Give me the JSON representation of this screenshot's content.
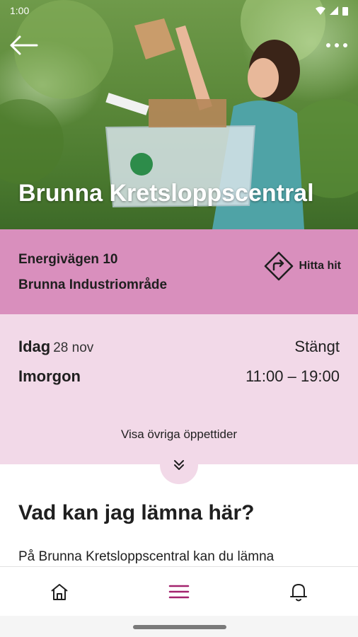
{
  "status_bar": {
    "time": "1:00"
  },
  "hero": {
    "title": "Brunna Kretsloppscentral"
  },
  "address": {
    "line1": "Energivägen 10",
    "line2": "Brunna Industriområde",
    "directions_label": "Hitta hit"
  },
  "hours": {
    "today_label": "Idag",
    "today_date": "28 nov",
    "today_value": "Stängt",
    "tomorrow_label": "Imorgon",
    "tomorrow_value": "11:00 – 19:00",
    "more_label": "Visa övriga öppettider"
  },
  "content": {
    "heading": "Vad kan jag lämna här?",
    "body": "På Brunna Kretsloppscentral kan du lämna"
  },
  "bottom_nav": {
    "items": [
      "home-icon",
      "menu-icon",
      "bell-icon"
    ]
  },
  "colors": {
    "accent": "#a3236e",
    "address_bg": "#d98fbd",
    "hours_bg": "#f2d9e8"
  }
}
